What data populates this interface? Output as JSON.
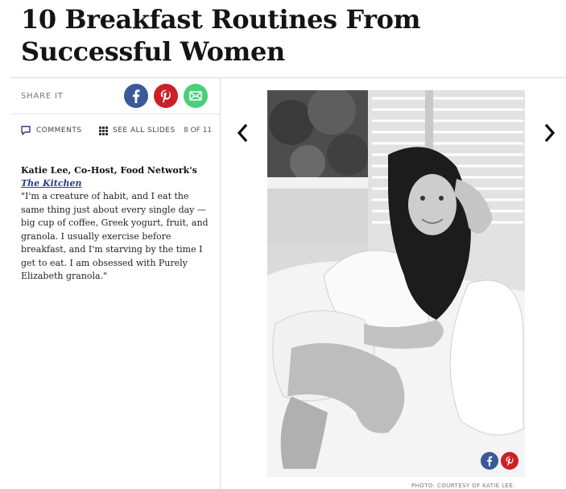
{
  "article": {
    "title": "10 Breakfast Routines From Successful Women"
  },
  "share": {
    "label": "SHARE IT",
    "buttons": [
      {
        "network": "facebook",
        "icon": "facebook-icon",
        "color": "#3b5998"
      },
      {
        "network": "pinterest",
        "icon": "pinterest-icon",
        "color": "#cb2027"
      },
      {
        "network": "email",
        "icon": "email-icon",
        "color": "#4bd07a"
      }
    ]
  },
  "toolbar": {
    "comments_label": "COMMENTS",
    "see_all_label": "SEE ALL SLIDES",
    "counter": "8 OF 11"
  },
  "slide": {
    "caption_name": "Katie Lee, Co-Host, Food Network's ",
    "caption_show": "The Kitchen",
    "caption_text": "\"I'm a creature of habit, and I eat the same thing just about every single day — big cup of coffee, Greek yogurt, fruit, and granola. I usually exercise before breakfast, and I'm starving by the time I get to eat. I am obsessed with Purely Elizabeth granola.\"",
    "photo_credit": "PHOTO: COURTESY OF KATIE LEE.",
    "link_color": "#2e3a8a"
  },
  "nav": {
    "prev_icon": "chevron-left-icon",
    "next_icon": "chevron-right-icon"
  }
}
